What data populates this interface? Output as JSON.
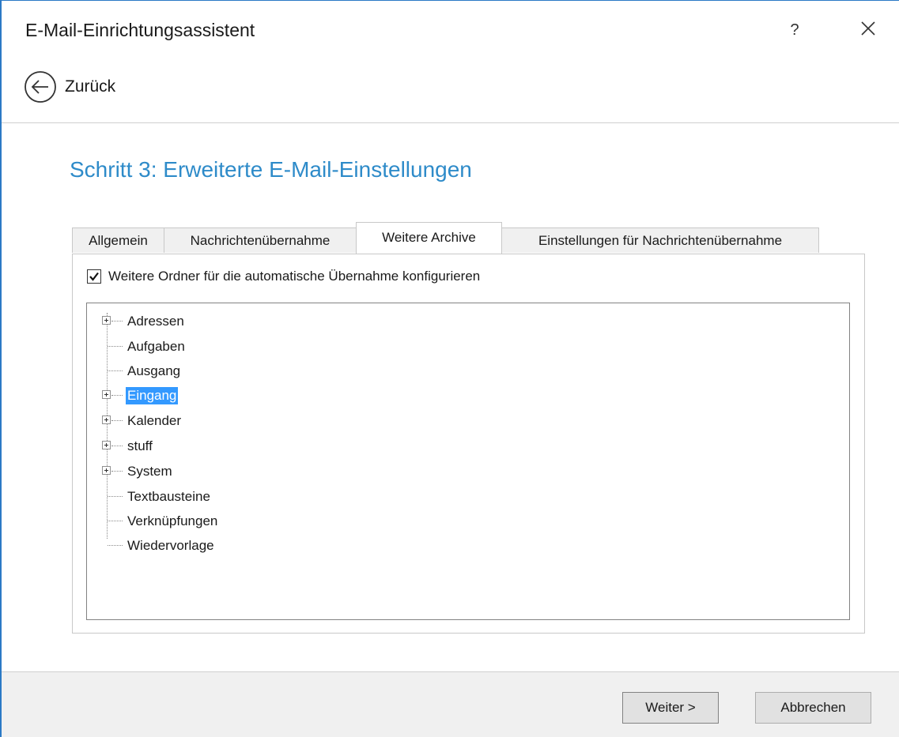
{
  "window": {
    "title": "E-Mail-Einrichtungsassistent",
    "help_label": "?",
    "accent_color": "#2b79c5"
  },
  "nav": {
    "back_label": "Zurück"
  },
  "step": {
    "title": "Schritt 3: Erweiterte E-Mail-Einstellungen",
    "title_color": "#2e8bc9"
  },
  "tabs": [
    {
      "label": "Allgemein",
      "active": false
    },
    {
      "label": "Nachrichtenübernahme",
      "active": false
    },
    {
      "label": "Weitere Archive",
      "active": true
    },
    {
      "label": "Einstellungen für Nachrichtenübernahme",
      "active": false
    }
  ],
  "options": {
    "configure_folders_label": "Weitere Ordner für die automatische Übernahme konfigurieren",
    "configure_folders_checked": true
  },
  "tree": {
    "items": [
      {
        "label": "Adressen",
        "expandable": true,
        "selected": false
      },
      {
        "label": "Aufgaben",
        "expandable": false,
        "selected": false
      },
      {
        "label": "Ausgang",
        "expandable": false,
        "selected": false
      },
      {
        "label": "Eingang",
        "expandable": true,
        "selected": true
      },
      {
        "label": "Kalender",
        "expandable": true,
        "selected": false
      },
      {
        "label": "stuff",
        "expandable": true,
        "selected": false
      },
      {
        "label": "System",
        "expandable": true,
        "selected": false
      },
      {
        "label": "Textbausteine",
        "expandable": false,
        "selected": false
      },
      {
        "label": "Verknüpfungen",
        "expandable": false,
        "selected": false
      },
      {
        "label": "Wiedervorlage",
        "expandable": false,
        "selected": false
      }
    ],
    "selection_color": "#3399ff"
  },
  "footer": {
    "next_label": "Weiter >",
    "cancel_label": "Abbrechen"
  }
}
